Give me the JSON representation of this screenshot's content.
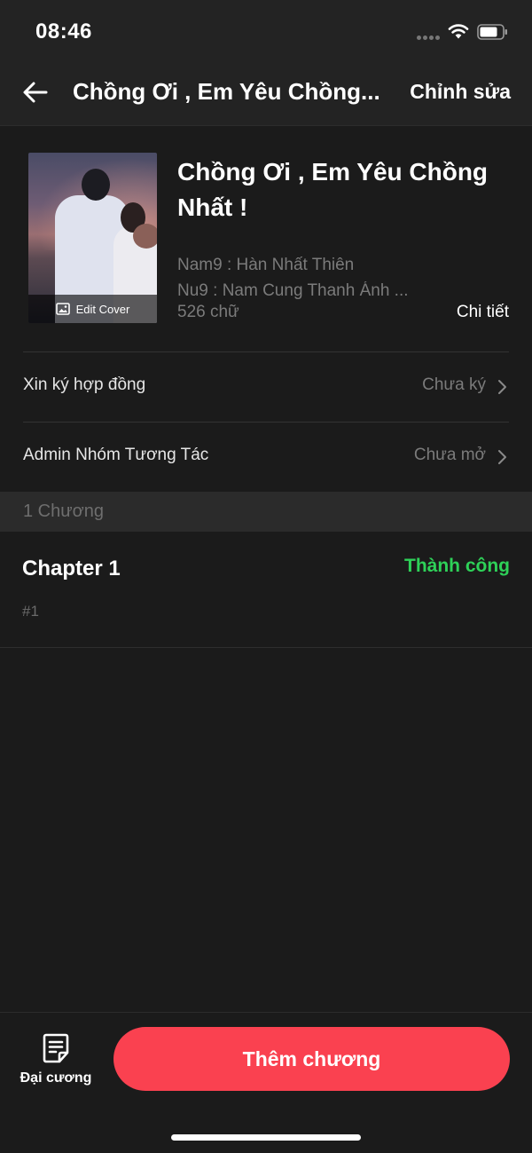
{
  "status_bar": {
    "time": "08:46"
  },
  "nav": {
    "title": "Chồng Ơi , Em Yêu Chồng...",
    "edit_label": "Chỉnh sửa"
  },
  "book": {
    "cover_label": "Edit Cover",
    "title": "Chồng Ơi , Em Yêu Chồng Nhất !",
    "male_lead": "Nam9 : Hàn Nhất Thiên",
    "female_lead": "Nu9 : Nam Cung Thanh Ánh ...",
    "word_count": "526 chữ",
    "detail_label": "Chi tiết"
  },
  "rows": [
    {
      "label": "Xin ký hợp đồng",
      "value": "Chưa ký"
    },
    {
      "label": "Admin Nhóm Tương Tác",
      "value": "Chưa mở"
    }
  ],
  "chapters_header": "1 Chương",
  "chapters": [
    {
      "title": "Chapter 1",
      "status": "Thành công",
      "number": "#1"
    }
  ],
  "bottom": {
    "outline_label": "Đại cương",
    "add_label": "Thêm chương"
  },
  "colors": {
    "background": "#1b1b1b",
    "accent": "#fa4150",
    "success": "#2ed158"
  },
  "icons": [
    "back-arrow-icon",
    "wifi-icon",
    "battery-icon",
    "image-icon",
    "chevron-right-icon",
    "document-icon"
  ]
}
